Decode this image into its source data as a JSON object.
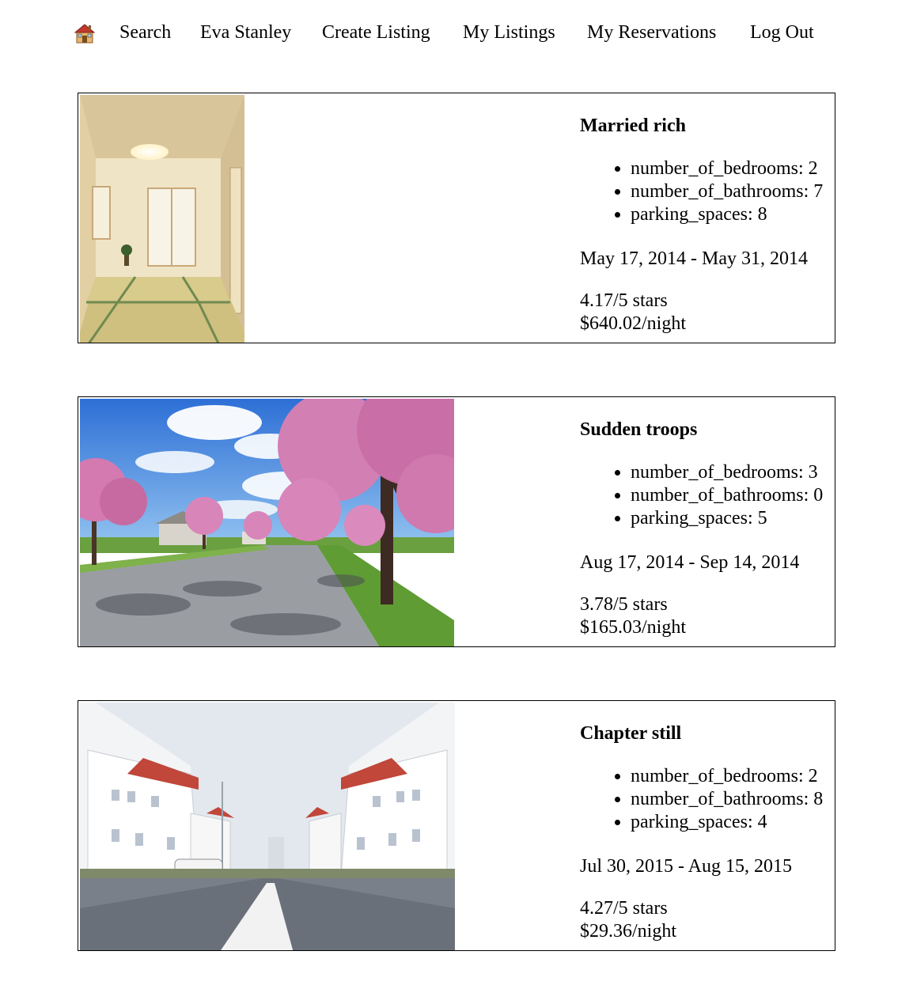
{
  "nav": {
    "home_icon": "house-icon",
    "search": "Search",
    "user": "Eva Stanley",
    "create_listing": "Create Listing",
    "my_listings": "My Listings",
    "my_reservations": "My Reservations",
    "log_out": "Log Out"
  },
  "reservations": [
    {
      "title": "Married rich",
      "bedrooms": "number_of_bedrooms: 2",
      "bathrooms": "number_of_bathrooms: 7",
      "parking": "parking_spaces: 8",
      "dates": "May 17, 2014 - May 31, 2014",
      "rating": "4.17/5 stars",
      "price": "$640.02/night"
    },
    {
      "title": "Sudden troops",
      "bedrooms": "number_of_bedrooms: 3",
      "bathrooms": "number_of_bathrooms: 0",
      "parking": "parking_spaces: 5",
      "dates": "Aug 17, 2014 - Sep 14, 2014",
      "rating": "3.78/5 stars",
      "price": "$165.03/night"
    },
    {
      "title": "Chapter still",
      "bedrooms": "number_of_bedrooms: 2",
      "bathrooms": "number_of_bathrooms: 8",
      "parking": "parking_spaces: 4",
      "dates": "Jul 30, 2015 - Aug 15, 2015",
      "rating": "4.27/5 stars",
      "price": "$29.36/night"
    }
  ]
}
